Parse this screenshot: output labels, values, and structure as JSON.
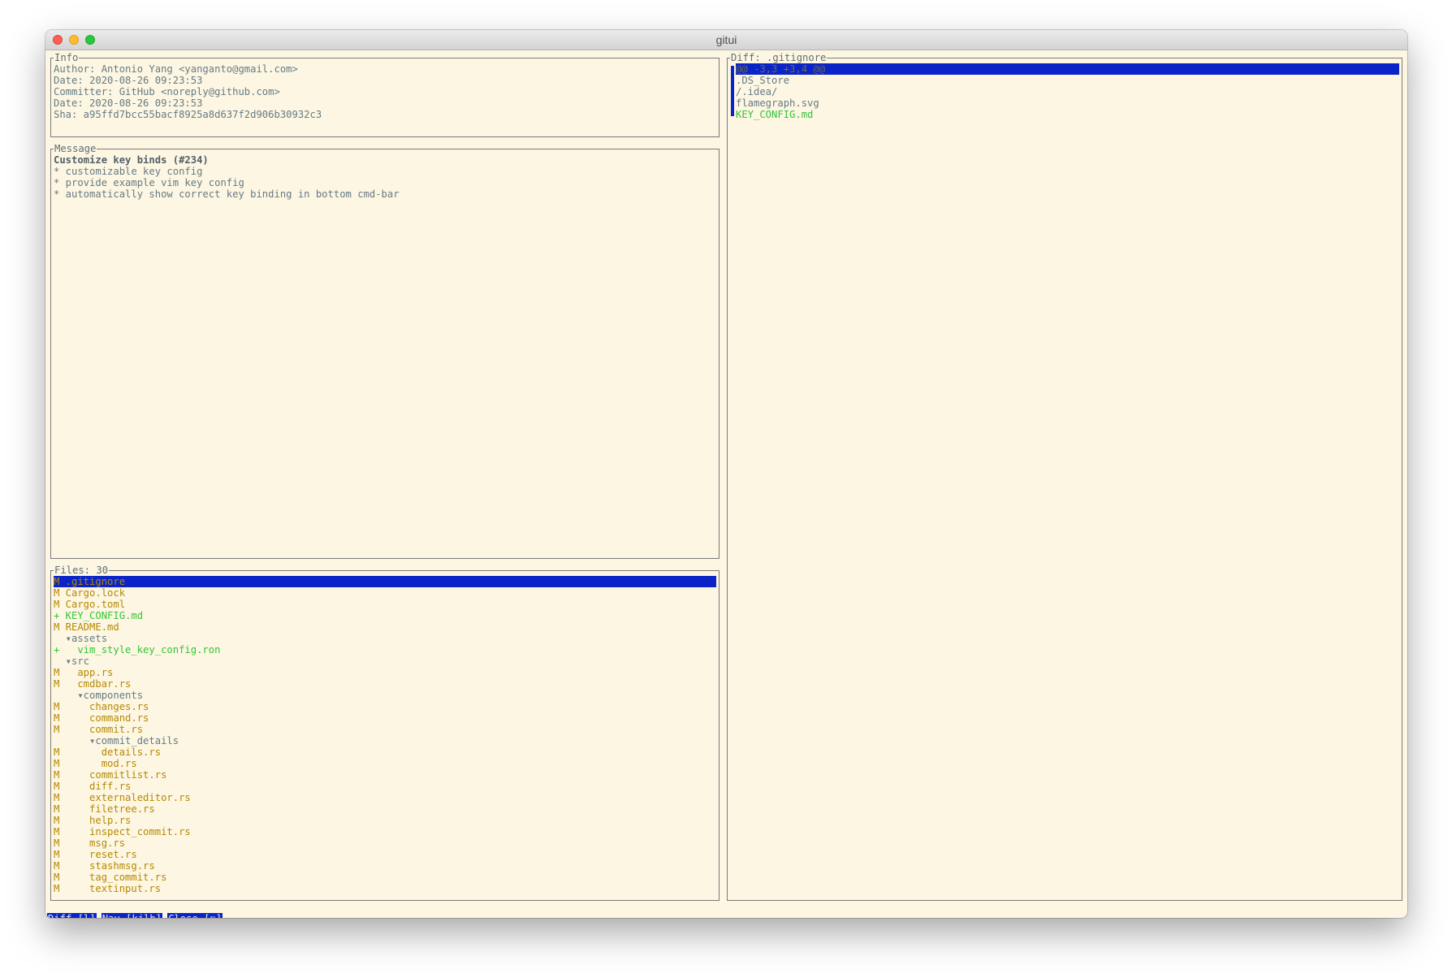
{
  "window": {
    "title": "gitui"
  },
  "info": {
    "title": "Info",
    "lines": [
      "Author: Antonio Yang <yanganto@gmail.com>",
      "Date: 2020-08-26 09:23:53",
      "Committer: GitHub <noreply@github.com>",
      "Date: 2020-08-26 09:23:53",
      "Sha: a95ffd7bcc55bacf8925a8d637f2d906b30932c3"
    ]
  },
  "message": {
    "title": "Message",
    "subject": "Customize key binds (#234)",
    "body": [
      "* customizable key config",
      "* provide example vim key config",
      "* automatically show correct key binding in bottom cmd-bar"
    ]
  },
  "files": {
    "title": "Files: 30",
    "items": [
      {
        "text": "M .gitignore",
        "color": "#b58900",
        "selected": true
      },
      {
        "text": "M Cargo.lock",
        "color": "#b58900"
      },
      {
        "text": "M Cargo.toml",
        "color": "#b58900"
      },
      {
        "text": "+ KEY_CONFIG.md",
        "color": "#34c534"
      },
      {
        "text": "M README.md",
        "color": "#b58900"
      },
      {
        "text": "  ▾assets",
        "color": "#657b83"
      },
      {
        "text": "+   vim_style_key_config.ron",
        "color": "#34c534"
      },
      {
        "text": "  ▾src",
        "color": "#657b83"
      },
      {
        "text": "M   app.rs",
        "color": "#b58900"
      },
      {
        "text": "M   cmdbar.rs",
        "color": "#b58900"
      },
      {
        "text": "    ▾components",
        "color": "#657b83"
      },
      {
        "text": "M     changes.rs",
        "color": "#b58900"
      },
      {
        "text": "M     command.rs",
        "color": "#b58900"
      },
      {
        "text": "M     commit.rs",
        "color": "#b58900"
      },
      {
        "text": "      ▾commit_details",
        "color": "#657b83"
      },
      {
        "text": "M       details.rs",
        "color": "#b58900"
      },
      {
        "text": "M       mod.rs",
        "color": "#b58900"
      },
      {
        "text": "M     commitlist.rs",
        "color": "#b58900"
      },
      {
        "text": "M     diff.rs",
        "color": "#b58900"
      },
      {
        "text": "M     externaleditor.rs",
        "color": "#b58900"
      },
      {
        "text": "M     filetree.rs",
        "color": "#b58900"
      },
      {
        "text": "M     help.rs",
        "color": "#b58900"
      },
      {
        "text": "M     inspect_commit.rs",
        "color": "#b58900"
      },
      {
        "text": "M     msg.rs",
        "color": "#b58900"
      },
      {
        "text": "M     reset.rs",
        "color": "#b58900"
      },
      {
        "text": "M     stashmsg.rs",
        "color": "#b58900"
      },
      {
        "text": "M     tag_commit.rs",
        "color": "#b58900"
      },
      {
        "text": "M     textinput.rs",
        "color": "#b58900"
      }
    ]
  },
  "diff": {
    "title": "Diff: .gitignore",
    "hunk": "@@ -3,3 +3,4 @@",
    "lines": [
      {
        "text": ".DS_Store",
        "color": "#657b83"
      },
      {
        "text": "/.idea/",
        "color": "#657b83"
      },
      {
        "text": "flamegraph.svg",
        "color": "#657b83"
      },
      {
        "text": "KEY_CONFIG.md",
        "color": "#34c534"
      }
    ]
  },
  "cmdbar": [
    {
      "label": "Diff [l]"
    },
    {
      "label": "Nav [kjlh]"
    },
    {
      "label": "Close [⎋]"
    }
  ],
  "colors": {
    "background": "#fdf6e3",
    "selection": "#0a24c8",
    "modified": "#b58900",
    "added": "#34c534"
  }
}
